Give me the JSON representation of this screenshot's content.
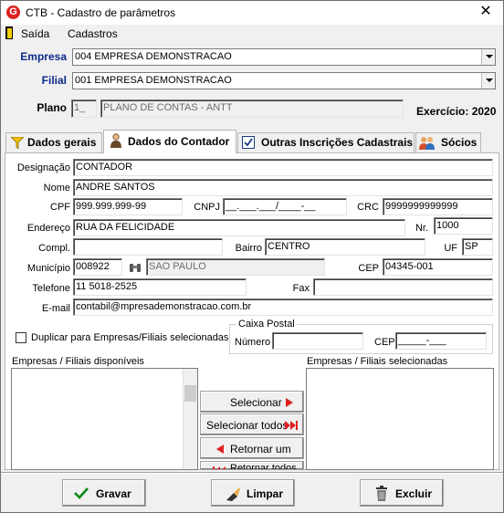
{
  "window": {
    "title": "CTB - Cadastro de parâmetros",
    "close_glyph": "✕"
  },
  "menu": {
    "items": [
      {
        "label": "Saída"
      },
      {
        "label": "Cadastros"
      }
    ]
  },
  "header": {
    "empresa_label": "Empresa",
    "empresa_value": "004 EMPRESA DEMONSTRACAO",
    "filial_label": "Filial",
    "filial_value": "001 EMPRESA DEMONSTRACAO",
    "plano_label": "Plano",
    "plano_code": "1_",
    "plano_name": "PLANO DE CONTAS - ANTT",
    "exercicio": "Exercício: 2020"
  },
  "tabs": [
    {
      "label": "Dados gerais",
      "icon": "funnel-icon"
    },
    {
      "label": "Dados do Contador",
      "icon": "person-icon"
    },
    {
      "label": "Outras Inscrições Cadastrais",
      "icon": "checkbox-icon"
    },
    {
      "label": "Sócios",
      "icon": "people-icon"
    }
  ],
  "form": {
    "designacao_label": "Designação",
    "designacao": "CONTADOR",
    "nome_label": "Nome",
    "nome": "ANDRE SANTOS",
    "cpf_label": "CPF",
    "cpf": "999.999.999-99",
    "cnpj_label": "CNPJ",
    "cnpj": "__.___.___/____-__",
    "crc_label": "CRC",
    "crc": "9999999999999",
    "endereco_label": "Endereço",
    "endereco": "RUA DA FELICIDADE",
    "nr_label": "Nr.",
    "nr": "1000",
    "compl_label": "Compl.",
    "compl": "",
    "bairro_label": "Bairro",
    "bairro": "CENTRO",
    "uf_label": "UF",
    "uf": "SP",
    "municipio_label": "Município",
    "municipio_code": "008922",
    "municipio_name": "SAO PAULO",
    "cep_label": "CEP",
    "cep": "04345-001",
    "telefone_label": "Telefone",
    "telefone": "11 5018-2525",
    "fax_label": "Fax",
    "fax": "",
    "email_label": "E-mail",
    "email": "contabil@mpresademonstracao.com.br",
    "duplicar_label": "Duplicar para Empresas/Filiais selecionadas",
    "caixa_postal_label": "Caixa Postal",
    "numero_label": "Número",
    "numero": "",
    "cp_cep_label": "CEP",
    "cp_cep": "_____-___"
  },
  "lists": {
    "available_label": "Empresas / Filiais disponíveis",
    "selected_label": "Empresas / Filiais selecionadas"
  },
  "transfer_buttons": {
    "selecionar": "Selecionar",
    "selecionar_todos": "Selecionar todos",
    "retornar_um": "Retornar um",
    "retornar_todos": "Retornar todos"
  },
  "footer": {
    "gravar": "Gravar",
    "limpar": "Limpar",
    "excluir": "Excluir"
  },
  "colors": {
    "label_blue": "#0b2a8a",
    "arrow_red": "#e02020",
    "check_green": "#0a8a1a"
  }
}
